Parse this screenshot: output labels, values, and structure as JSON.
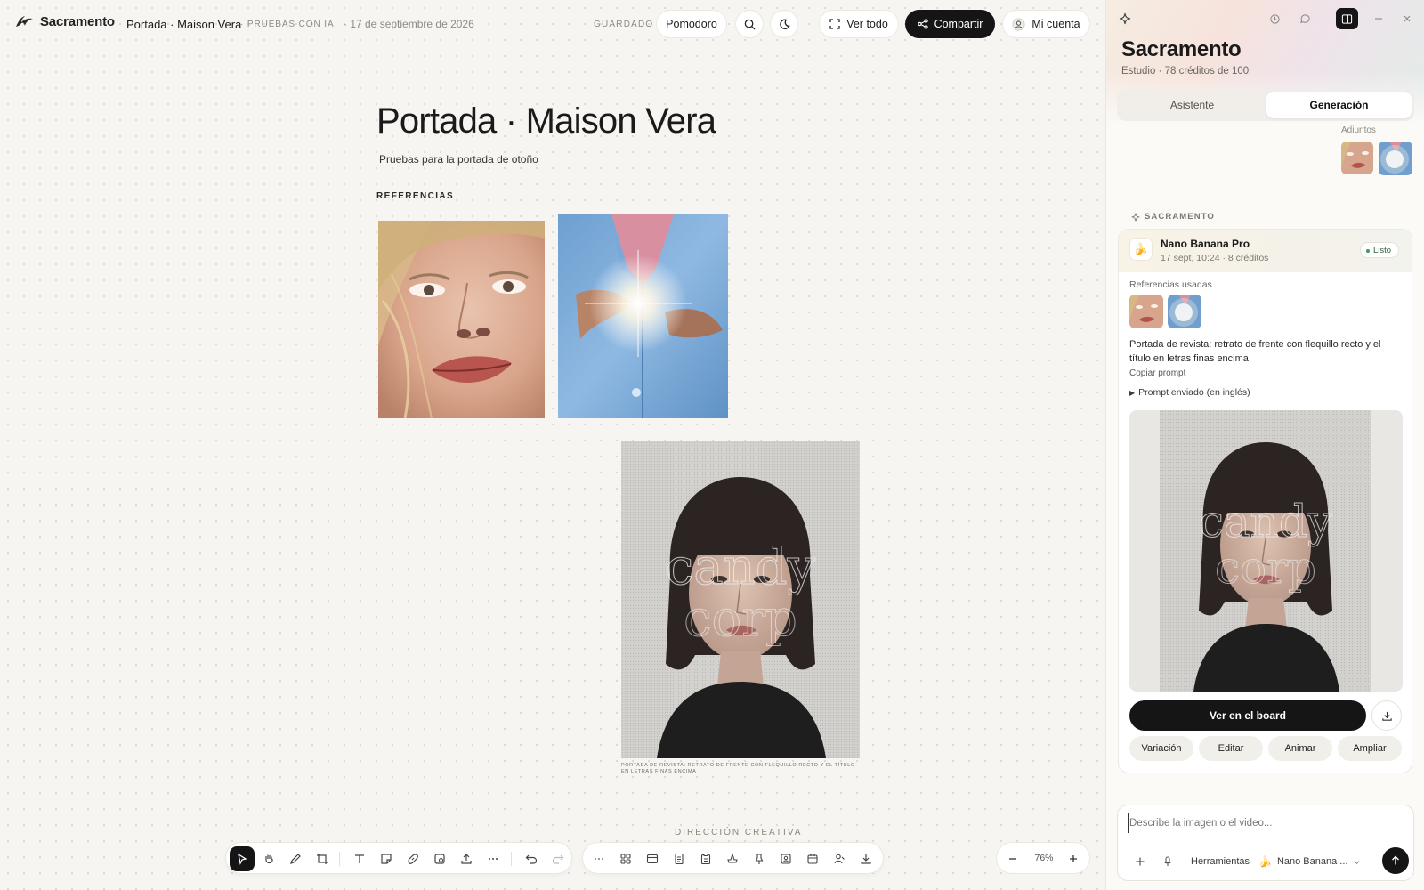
{
  "app": {
    "brand": "Sacramento"
  },
  "header": {
    "doc_title": "Portada · Maison Vera",
    "crumb": "· PRUEBAS CON IA",
    "date": "· 17 de septiembre de 2026",
    "saved": "GUARDADO",
    "pomodoro": "Pomodoro",
    "view_all": "Ver todo",
    "share": "Compartir",
    "account": "Mi cuenta"
  },
  "board": {
    "title": "Portada · Maison Vera",
    "subtitle": "Pruebas para la portada de otoño",
    "references_label": "REFERENCIAS",
    "caption": "PORTADA DE REVISTA: RETRATO DE FRENTE CON FLEQUILLO RECTO Y EL TÍTULO EN LETRAS FINAS ENCIMA",
    "creative_label": "DIRECCIÓN CREATIVA"
  },
  "toolbar": {
    "zoom": "76%"
  },
  "panel": {
    "title": "Sacramento",
    "subtitle": "Estudio · 78 créditos de 100",
    "tabs": [
      "Asistente",
      "Generación"
    ],
    "attachments_label": "Adjuntos",
    "section_label": "SACRAMENTO",
    "card": {
      "model": "Nano Banana Pro",
      "meta": "17 sept, 10:24 · 8 créditos",
      "status": "Listo",
      "refs_label": "Referencias usadas",
      "prompt": "Portada de revista: retrato de frente con flequillo recto y el título en letras finas encima",
      "copy_prompt": "Copiar prompt",
      "sent_prompt": "Prompt enviado (en inglés)",
      "view_board": "Ver en el board",
      "actions": [
        "Variación",
        "Editar",
        "Animar",
        "Ampliar"
      ]
    },
    "composer": {
      "placeholder": "Describe la imagen o el video...",
      "tools": "Herramientas",
      "model": "Nano Banana ..."
    }
  },
  "colors": {
    "accent_dark": "#151515",
    "ready_green": "#3c9b56",
    "canvas_bg": "#f7f5f1"
  },
  "icons": [
    "logo-icon",
    "search-icon",
    "moon-icon",
    "expand-icon",
    "share-icon",
    "user-icon",
    "sparkle-icon",
    "history-icon",
    "chat-icon",
    "panel-icon",
    "minimize-icon",
    "close-icon",
    "download-icon",
    "plus-icon",
    "mic-icon",
    "send-icon"
  ]
}
